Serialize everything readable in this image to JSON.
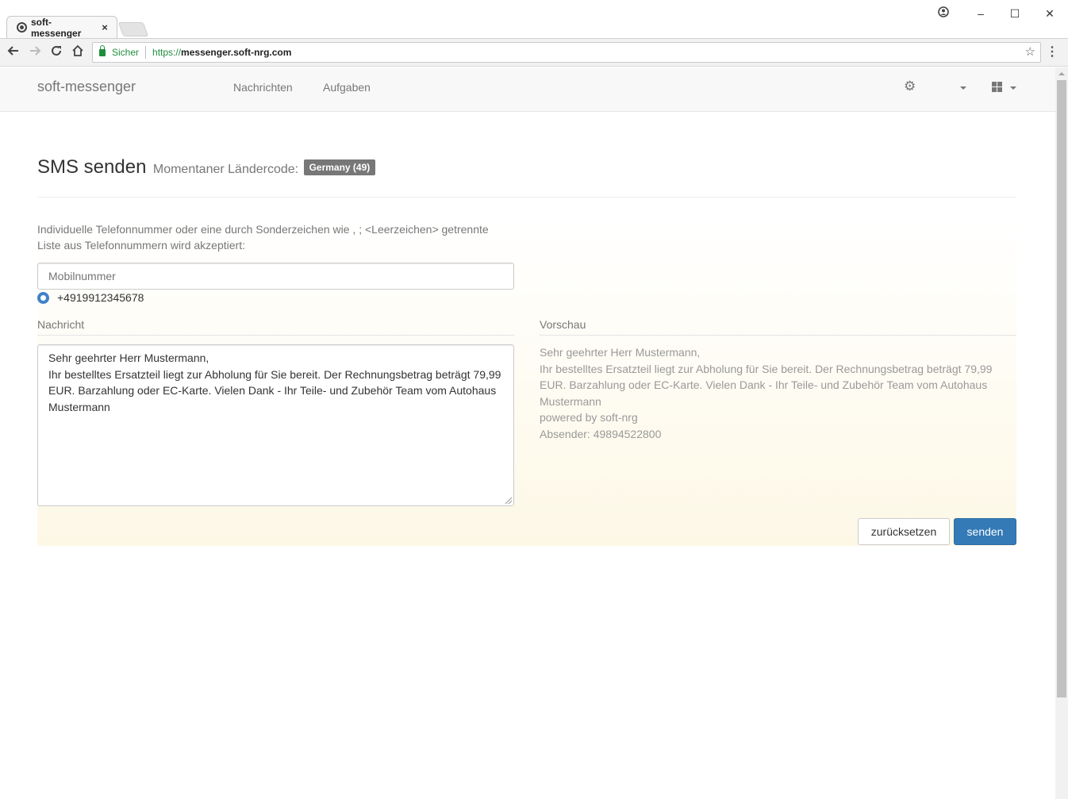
{
  "browser": {
    "tab_title": "soft-messenger",
    "tab_close": "×",
    "security_label": "Sicher",
    "url_scheme": "https://",
    "url_host": "messenger.soft-nrg.com",
    "window_controls": {
      "minimize": "–",
      "maximize": "☐",
      "close": "✕"
    }
  },
  "navbar": {
    "brand": "soft-messenger",
    "links": [
      "Nachrichten",
      "Aufgaben"
    ]
  },
  "header": {
    "title": "SMS senden",
    "subtitle": "Momentaner Ländercode:",
    "country_badge": "Germany (49)"
  },
  "form": {
    "help_text": "Individuelle Telefonnummer oder eine durch Sonderzeichen wie , ; <Leerzeichen> getrennte Liste aus Telefonnummern wird akzeptiert:",
    "mobile_placeholder": "Mobilnummer",
    "selected_number": "+4919912345678",
    "message_label": "Nachricht",
    "message_text": "Sehr geehrter Herr Mustermann,\nIhr bestelltes Ersatzteil liegt zur Abholung für Sie bereit. Der Rechnungsbetrag beträgt 79,99 EUR. Barzahlung oder EC-Karte. Vielen Dank - Ihr Teile- und Zubehör Team vom Autohaus Mustermann",
    "preview_label": "Vorschau",
    "preview_lines": [
      "Sehr geehrter Herr Mustermann,",
      "Ihr bestelltes Ersatzteil liegt zur Abholung für Sie bereit. Der Rechnungsbetrag beträgt 79,99 EUR. Barzahlung oder EC-Karte. Vielen Dank - Ihr Teile- und Zubehör Team vom Autohaus Mustermann",
      "powered by soft-nrg",
      "Absender: 49894522800"
    ],
    "reset_button": "zurücksetzen",
    "send_button": "senden"
  },
  "colors": {
    "primary": "#337ab7",
    "badge": "#777777",
    "panel_tint": "#fdf8e6"
  }
}
